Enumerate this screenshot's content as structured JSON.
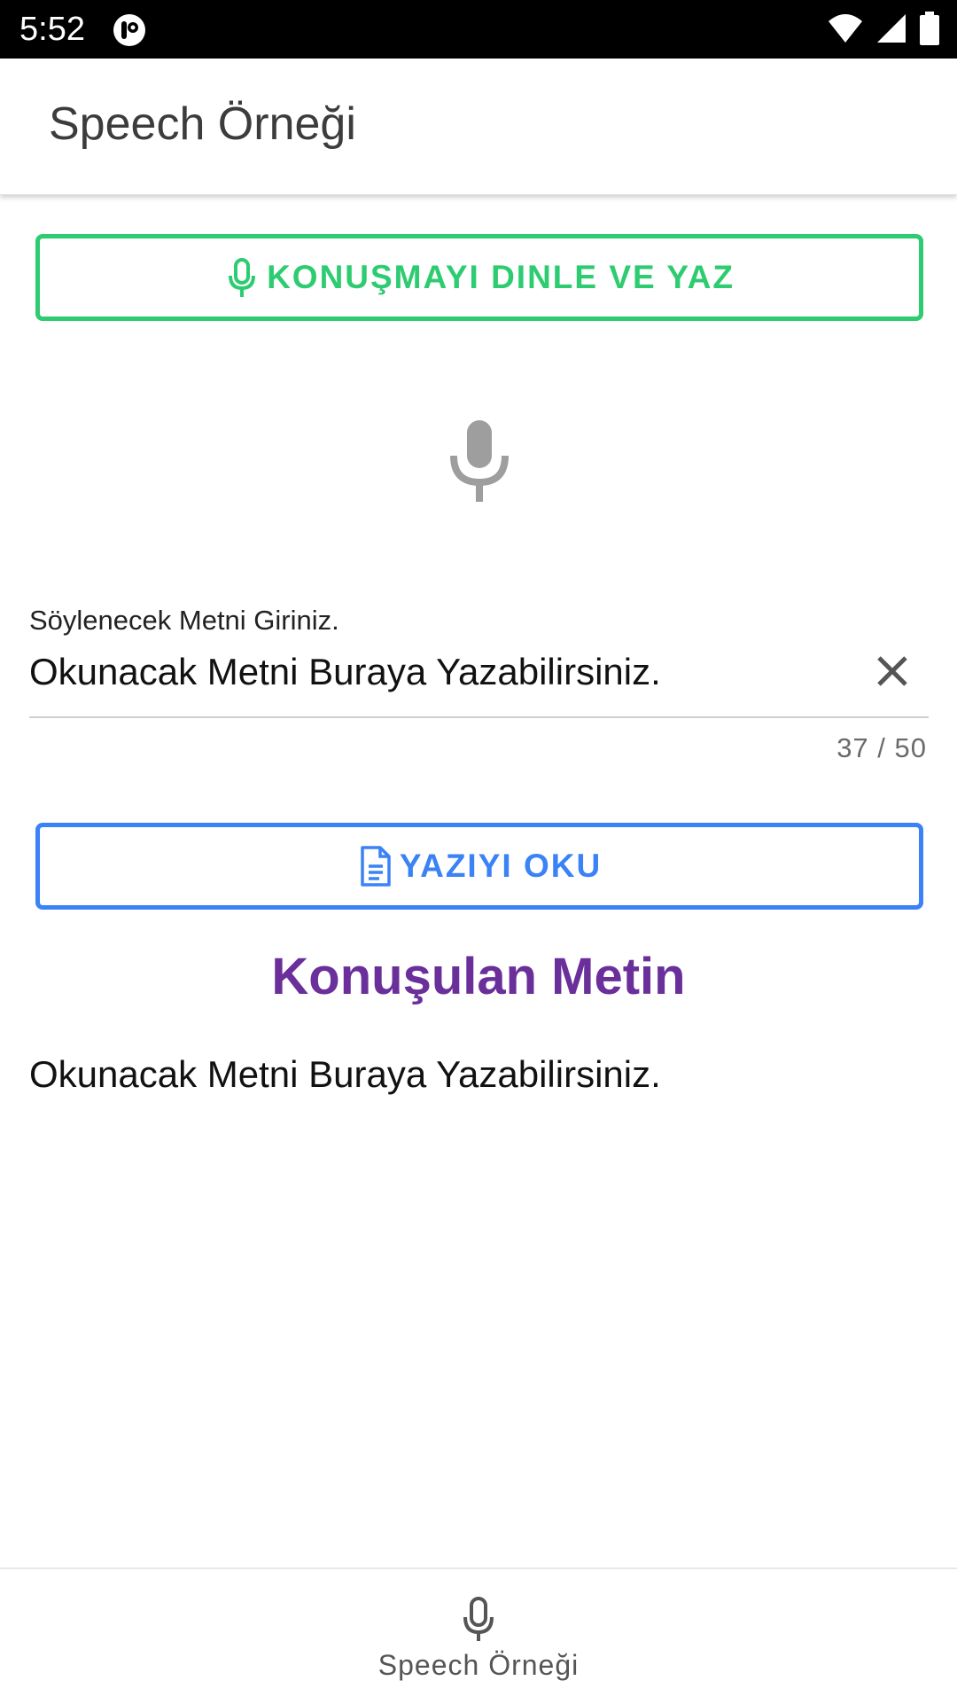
{
  "status_bar": {
    "time": "5:52",
    "icons": [
      "app-notification-icon",
      "wifi-icon",
      "cellular-signal-icon",
      "battery-icon"
    ]
  },
  "app_bar": {
    "title": "Speech Örneği"
  },
  "listen_button": {
    "label": "KONUŞMAYI DINLE VE YAZ",
    "icon": "microphone-icon",
    "color": "#2ecc71"
  },
  "center_icon": "microphone-icon",
  "text_field": {
    "label": "Söylenecek Metni Giriniz.",
    "value": "Okunacak Metni Buraya Yazabilirsiniz.",
    "counter": "37 / 50"
  },
  "read_button": {
    "label": "YAZIYI OKU",
    "icon": "document-icon",
    "color": "#3b82f6"
  },
  "spoken_section": {
    "title": "Konuşulan Metin",
    "title_color": "#6a2f9a",
    "text": "Okunacak Metni Buraya Yazabilirsiniz."
  },
  "bottom_nav": {
    "items": [
      {
        "label": "Speech Örneği",
        "icon": "microphone-icon"
      }
    ]
  }
}
